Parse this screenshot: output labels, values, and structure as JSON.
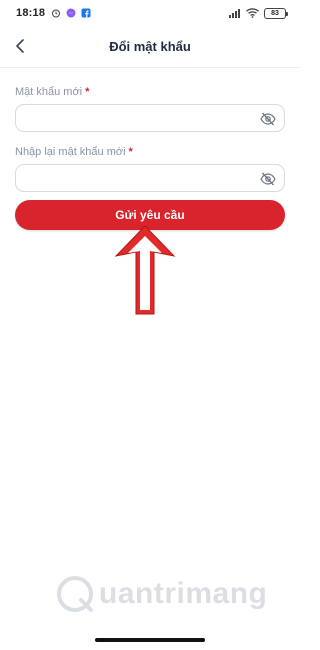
{
  "status_bar": {
    "time": "18:18",
    "battery": "83",
    "left_icons": [
      "alarm-icon",
      "messenger-icon",
      "facebook-icon"
    ],
    "right_icons": [
      "signal-icon",
      "wifi-icon",
      "battery-icon"
    ]
  },
  "header": {
    "title": "Đổi mật khẩu",
    "back_icon": "chevron-left-icon"
  },
  "form": {
    "new_password": {
      "label": "Mật khẩu mới",
      "required_mark": "*",
      "value": "",
      "placeholder": ""
    },
    "confirm_password": {
      "label": "Nhập lại mật khẩu mới",
      "required_mark": "*",
      "value": "",
      "placeholder": ""
    }
  },
  "submit": {
    "label": "Gửi yêu cầu"
  },
  "watermark": {
    "text": "uantrimang"
  },
  "colors": {
    "accent": "#d9232d",
    "title": "#1f2a44",
    "label": "#8b93a3",
    "border": "#d6dae1"
  }
}
